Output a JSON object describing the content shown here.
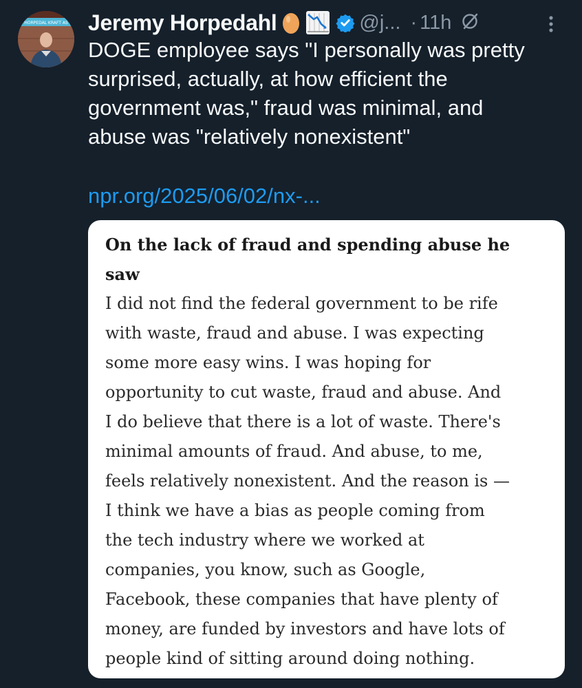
{
  "tweet": {
    "author": {
      "display_name": "Jeremy Horpedahl",
      "emoji": [
        "egg-emoji",
        "chart-decreasing-emoji"
      ],
      "verified": true,
      "handle": "@j...",
      "avatar_sign_text": "HORPEDAL KRAFT AS"
    },
    "separator": "·",
    "time": "11h",
    "text_lines": [
      "DOGE employee says \"I personally was pretty",
      "surprised, actually, at how efficient the",
      "government was,\" fraud was minimal, and",
      "abuse was \"relatively nonexistent\""
    ],
    "link": "npr.org/2025/06/02/nx-...",
    "quote": {
      "heading_lines": [
        "On the lack of fraud and spending abuse he",
        "saw"
      ],
      "body_lines": [
        "I did not find the federal government to be rife",
        "with waste, fraud and abuse. I was expecting",
        "some more easy wins. I was hoping for",
        "opportunity to cut waste, fraud and abuse. And",
        "I do believe that there is a lot of waste. There's",
        "minimal amounts of fraud. And abuse, to me,",
        "feels relatively nonexistent. And the reason is —",
        "I think we have a bias as people coming from",
        "the tech industry where we worked at",
        "companies, you know, such as Google,",
        "Facebook, these companies that have plenty of",
        "money, are funded by investors and have lots of",
        "people kind of sitting around doing nothing."
      ]
    }
  },
  "colors": {
    "background": "#15202b",
    "primary_text": "#f7f9f9",
    "secondary_text": "#8b98a5",
    "link": "#1d9bf0",
    "verified_badge": "#1d9bf0",
    "card_background": "#ffffff"
  }
}
